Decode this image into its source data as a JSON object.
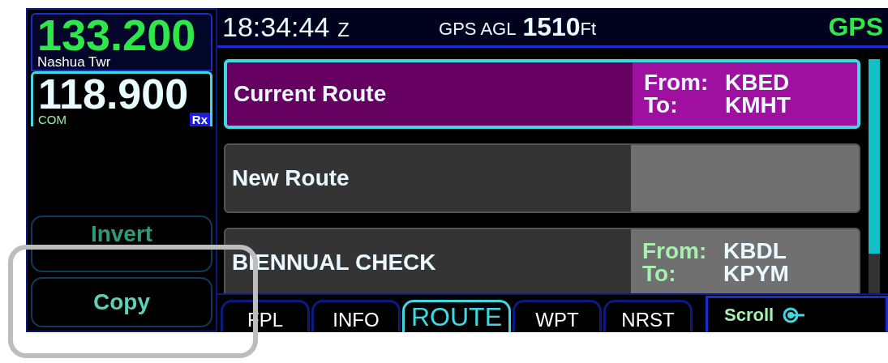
{
  "com": {
    "active_freq": "133.200",
    "station": "Nashua Twr",
    "standby_freq": "118.900",
    "label": "COM",
    "rx_badge": "Rx"
  },
  "softkeys": [
    {
      "label": "Invert",
      "disabled": true
    },
    {
      "label": "Copy",
      "disabled": false
    }
  ],
  "header": {
    "time": "18:34:44",
    "time_zone": "Z",
    "agl_label": "GPS AGL",
    "agl_value": "1510",
    "agl_unit": "Ft",
    "nav_source": "GPS"
  },
  "routes": [
    {
      "name": "Current Route",
      "selected": true,
      "from_label": "From:",
      "from": "KBED",
      "to_label": "To:",
      "to": "KMHT"
    },
    {
      "name": "New Route",
      "selected": false
    },
    {
      "name": "BIENNUAL CHECK",
      "selected": false,
      "from_label": "From:",
      "from": "KBDL",
      "to_label": "To:",
      "to": "KPYM"
    }
  ],
  "tabs": [
    {
      "label": "FPL",
      "selected": false
    },
    {
      "label": "INFO",
      "selected": false
    },
    {
      "label": "ROUTE",
      "selected": true
    },
    {
      "label": "WPT",
      "selected": false
    },
    {
      "label": "NRST",
      "selected": false
    }
  ],
  "scroll": {
    "label": "Scroll"
  }
}
